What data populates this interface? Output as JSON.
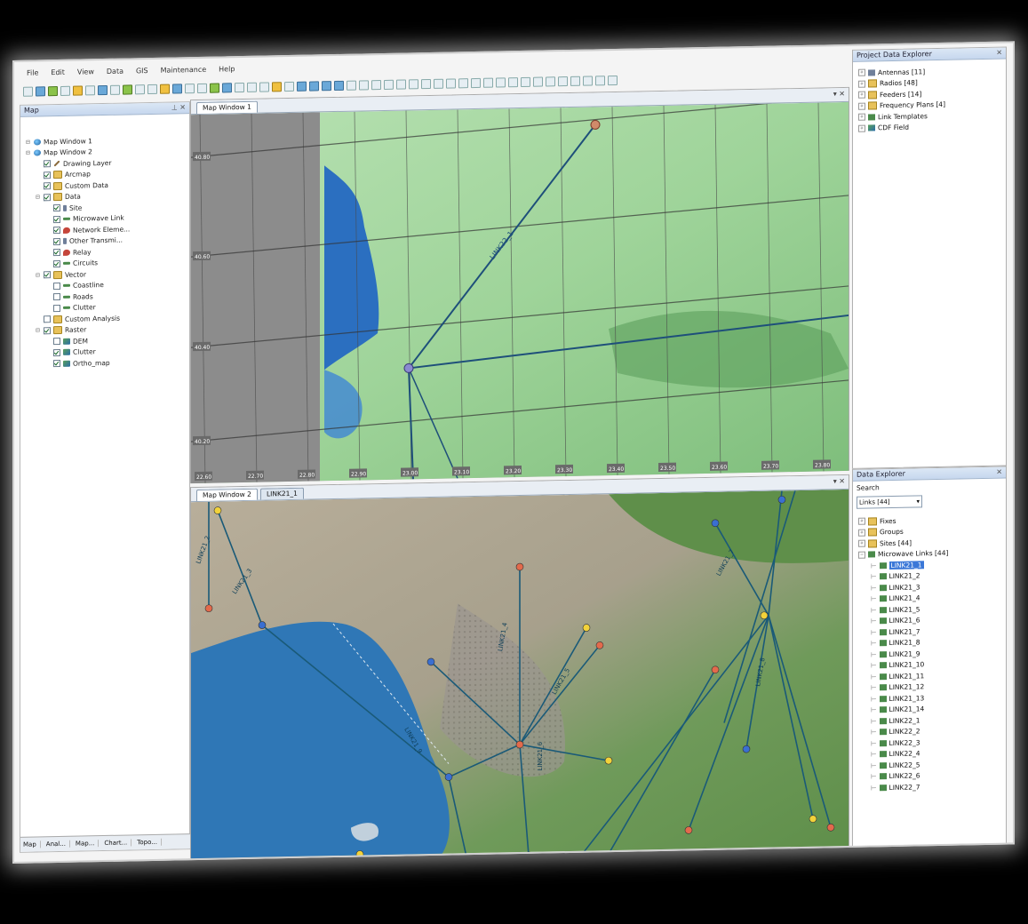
{
  "menu": [
    "File",
    "Edit",
    "View",
    "Data",
    "GIS",
    "Maintenance",
    "Help"
  ],
  "left_panel": {
    "title": "Map",
    "tree": [
      {
        "label": "Map Window 1",
        "icon": "globe-icon",
        "depth": 0,
        "expander": "⊟",
        "checkbox": null
      },
      {
        "label": "Map Window 2",
        "icon": "globe-icon",
        "depth": 0,
        "expander": "⊟",
        "checkbox": null
      },
      {
        "label": "Drawing Layer",
        "icon": "pen-icon",
        "depth": 1,
        "expander": "",
        "checkbox": true
      },
      {
        "label": "Arcmap",
        "icon": "folder-icon",
        "depth": 1,
        "expander": "",
        "checkbox": true
      },
      {
        "label": "Custom Data",
        "icon": "folder-icon",
        "depth": 1,
        "expander": "",
        "checkbox": true
      },
      {
        "label": "Data",
        "icon": "folder-icon",
        "depth": 1,
        "expander": "⊟",
        "checkbox": true
      },
      {
        "label": "Site",
        "icon": "antenna-icon",
        "depth": 2,
        "expander": "",
        "checkbox": true
      },
      {
        "label": "Microwave Link",
        "icon": "link-icon",
        "depth": 2,
        "expander": "",
        "checkbox": true
      },
      {
        "label": "Network Eleme...",
        "icon": "pin-icon",
        "depth": 2,
        "expander": "",
        "checkbox": true
      },
      {
        "label": "Other Transmi...",
        "icon": "antenna-icon",
        "depth": 2,
        "expander": "",
        "checkbox": true
      },
      {
        "label": "Relay",
        "icon": "pin-icon",
        "depth": 2,
        "expander": "",
        "checkbox": true
      },
      {
        "label": "Circuits",
        "icon": "link-icon",
        "depth": 2,
        "expander": "",
        "checkbox": true
      },
      {
        "label": "Vector",
        "icon": "folder-icon",
        "depth": 1,
        "expander": "⊟",
        "checkbox": true
      },
      {
        "label": "Coastline",
        "icon": "link-icon",
        "depth": 2,
        "expander": "",
        "checkbox": false
      },
      {
        "label": "Roads",
        "icon": "link-icon",
        "depth": 2,
        "expander": "",
        "checkbox": false
      },
      {
        "label": "Clutter",
        "icon": "link-icon",
        "depth": 2,
        "expander": "",
        "checkbox": false
      },
      {
        "label": "Custom Analysis",
        "icon": "folder-icon",
        "depth": 1,
        "expander": "",
        "checkbox": false
      },
      {
        "label": "Raster",
        "icon": "folder-icon",
        "depth": 1,
        "expander": "⊟",
        "checkbox": true
      },
      {
        "label": "DEM",
        "icon": "raster-icon",
        "depth": 2,
        "expander": "",
        "checkbox": false
      },
      {
        "label": "Clutter",
        "icon": "raster-icon",
        "depth": 2,
        "expander": "",
        "checkbox": true
      },
      {
        "label": "Ortho_map",
        "icon": "raster-icon",
        "depth": 2,
        "expander": "",
        "checkbox": true
      }
    ],
    "bottom_tabs": [
      "Map",
      "Anal...",
      "Map...",
      "Chart...",
      "Topo..."
    ]
  },
  "map1": {
    "tabs": [
      "Map Window 1"
    ],
    "link_label": "LINK22_1",
    "grid_labels_left": [
      "40.80",
      "40.60",
      "40.40",
      "40.20"
    ],
    "grid_labels_bottom": [
      "22.60",
      "22.70",
      "22.80",
      "22.90",
      "23.00",
      "23.10",
      "23.20",
      "23.30",
      "23.40",
      "23.50",
      "23.60",
      "23.70",
      "23.80"
    ]
  },
  "map2": {
    "tabs": [
      "Map Window 2",
      "LINK21_1"
    ],
    "link_labels": [
      "LINK21_2",
      "LINK21_3",
      "LINK21_4",
      "LINK21_5",
      "LINK21_6",
      "LINK21_7",
      "LINK21_8",
      "LINK21_9"
    ]
  },
  "project_explorer": {
    "title": "Project Data Explorer",
    "items": [
      {
        "label": "Antennas [11]",
        "icon": "antenna-icon"
      },
      {
        "label": "Radios [48]",
        "icon": "folder-icon"
      },
      {
        "label": "Feeders [14]",
        "icon": "folder-icon"
      },
      {
        "label": "Frequency Plans [4]",
        "icon": "folder-icon"
      },
      {
        "label": "Link Templates",
        "icon": "link-icon"
      },
      {
        "label": "CDF Field",
        "icon": "raster-icon"
      }
    ]
  },
  "data_explorer": {
    "title": "Data Explorer",
    "search_label": "Search",
    "filter_value": "Links [44]",
    "items": [
      {
        "label": "Fixes",
        "icon": "folder-icon"
      },
      {
        "label": "Groups",
        "icon": "folder-icon"
      },
      {
        "label": "Sites [44]",
        "icon": "folder-icon"
      },
      {
        "label": "Microwave Links [44]",
        "icon": "link-icon"
      }
    ],
    "links": [
      "LINK21_1",
      "LINK21_2",
      "LINK21_3",
      "LINK21_4",
      "LINK21_5",
      "LINK21_6",
      "LINK21_7",
      "LINK21_8",
      "LINK21_9",
      "LINK21_10",
      "LINK21_11",
      "LINK21_12",
      "LINK21_13",
      "LINK21_14",
      "LINK22_1",
      "LINK22_2",
      "LINK22_3",
      "LINK22_4",
      "LINK22_5",
      "LINK22_6",
      "LINK22_7"
    ],
    "selected_link": "LINK21_1"
  }
}
